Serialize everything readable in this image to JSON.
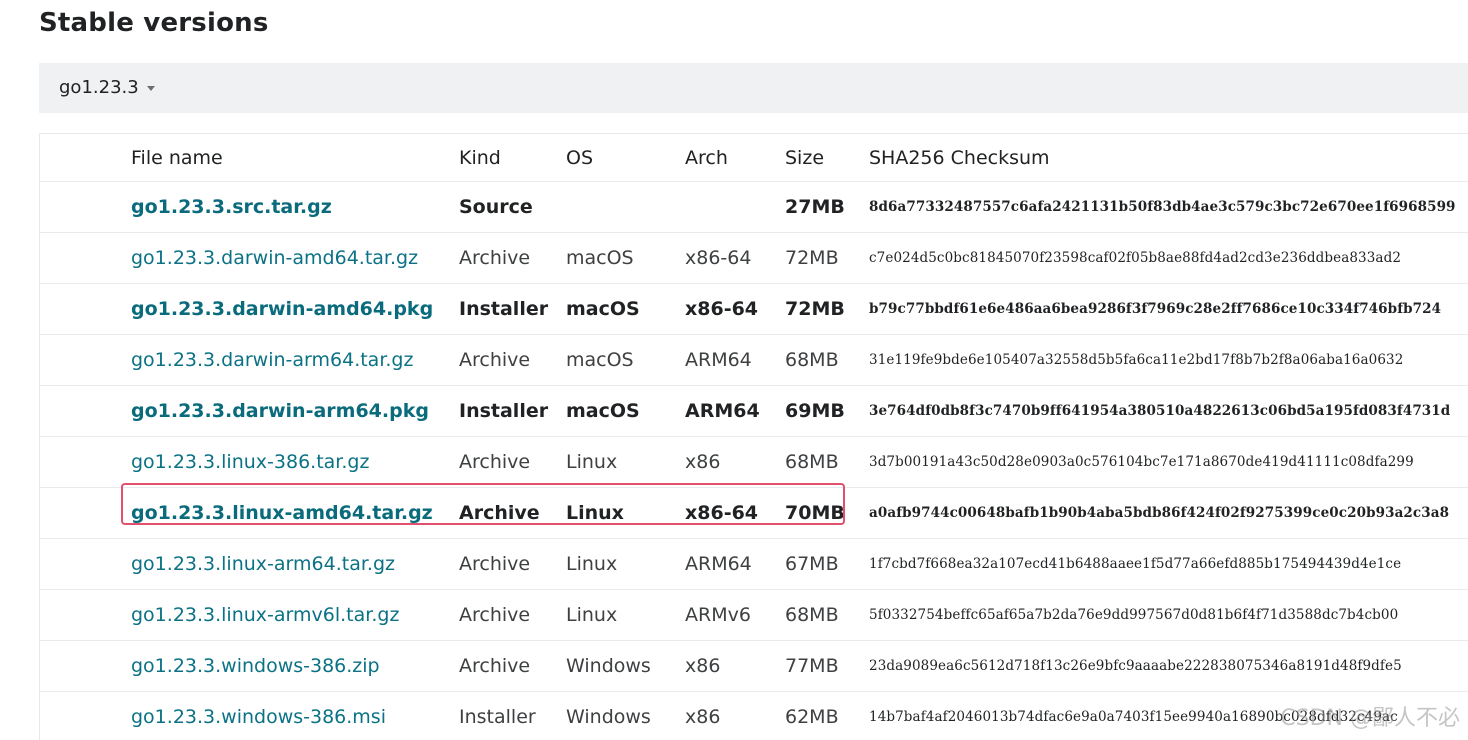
{
  "page": {
    "heading": "Stable versions",
    "version_selector": {
      "selected": "go1.23.3"
    }
  },
  "table": {
    "headers": [
      "File name",
      "Kind",
      "OS",
      "Arch",
      "Size",
      "SHA256 Checksum"
    ],
    "rows": [
      {
        "name": "go1.23.3.src.tar.gz",
        "kind": "Source",
        "os": "",
        "arch": "",
        "size": "27MB",
        "sha": "8d6a77332487557c6afa2421131b50f83db4ae3c579c3bc72e670ee1f6968599",
        "primary": true
      },
      {
        "name": "go1.23.3.darwin-amd64.tar.gz",
        "kind": "Archive",
        "os": "macOS",
        "arch": "x86-64",
        "size": "72MB",
        "sha": "c7e024d5c0bc81845070f23598caf02f05b8ae88fd4ad2cd3e236ddbea833ad2",
        "primary": false
      },
      {
        "name": "go1.23.3.darwin-amd64.pkg",
        "kind": "Installer",
        "os": "macOS",
        "arch": "x86-64",
        "size": "72MB",
        "sha": "b79c77bbdf61e6e486aa6bea9286f3f7969c28e2ff7686ce10c334f746bfb724",
        "primary": true
      },
      {
        "name": "go1.23.3.darwin-arm64.tar.gz",
        "kind": "Archive",
        "os": "macOS",
        "arch": "ARM64",
        "size": "68MB",
        "sha": "31e119fe9bde6e105407a32558d5b5fa6ca11e2bd17f8b7b2f8a06aba16a0632",
        "primary": false
      },
      {
        "name": "go1.23.3.darwin-arm64.pkg",
        "kind": "Installer",
        "os": "macOS",
        "arch": "ARM64",
        "size": "69MB",
        "sha": "3e764df0db8f3c7470b9ff641954a380510a4822613c06bd5a195fd083f4731d",
        "primary": true
      },
      {
        "name": "go1.23.3.linux-386.tar.gz",
        "kind": "Archive",
        "os": "Linux",
        "arch": "x86",
        "size": "68MB",
        "sha": "3d7b00191a43c50d28e0903a0c576104bc7e171a8670de419d41111c08dfa299",
        "primary": false
      },
      {
        "name": "go1.23.3.linux-amd64.tar.gz",
        "kind": "Archive",
        "os": "Linux",
        "arch": "x86-64",
        "size": "70MB",
        "sha": "a0afb9744c00648bafb1b90b4aba5bdb86f424f02f9275399ce0c20b93a2c3a8",
        "primary": true
      },
      {
        "name": "go1.23.3.linux-arm64.tar.gz",
        "kind": "Archive",
        "os": "Linux",
        "arch": "ARM64",
        "size": "67MB",
        "sha": "1f7cbd7f668ea32a107ecd41b6488aaee1f5d77a66efd885b175494439d4e1ce",
        "primary": false
      },
      {
        "name": "go1.23.3.linux-armv6l.tar.gz",
        "kind": "Archive",
        "os": "Linux",
        "arch": "ARMv6",
        "size": "68MB",
        "sha": "5f0332754beffc65af65a7b2da76e9dd997567d0d81b6f4f71d3588dc7b4cb00",
        "primary": false
      },
      {
        "name": "go1.23.3.windows-386.zip",
        "kind": "Archive",
        "os": "Windows",
        "arch": "x86",
        "size": "77MB",
        "sha": "23da9089ea6c5612d718f13c26e9bfc9aaaabe222838075346a8191d48f9dfe5",
        "primary": false
      },
      {
        "name": "go1.23.3.windows-386.msi",
        "kind": "Installer",
        "os": "Windows",
        "arch": "x86",
        "size": "62MB",
        "sha": "14b7baf4af2046013b74dfac6e9a0a7403f15ee9940a16890bc028dfd32c49ac",
        "primary": false
      }
    ]
  },
  "watermark": "CSDN @鄙人不必",
  "colors": {
    "link": "#0b7285",
    "highlight_border": "#e3506d",
    "bar_bg": "#f0f1f2"
  }
}
